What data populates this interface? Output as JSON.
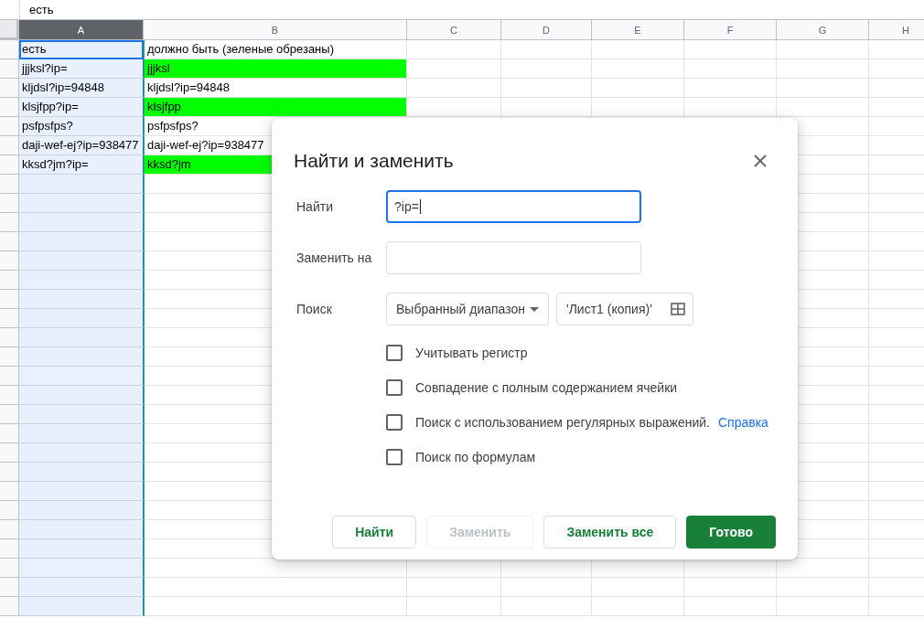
{
  "formula_bar": {
    "value": "есть"
  },
  "columns": [
    {
      "label": "A",
      "selected": true
    },
    {
      "label": "B",
      "selected": false
    },
    {
      "label": "C",
      "selected": false
    },
    {
      "label": "D",
      "selected": false
    },
    {
      "label": "E",
      "selected": false
    },
    {
      "label": "F",
      "selected": false
    },
    {
      "label": "G",
      "selected": false
    },
    {
      "label": "H",
      "selected": false
    }
  ],
  "rows": [
    {
      "cells": [
        {
          "text": "есть",
          "highlighted": false
        },
        {
          "text": "должно быть (зеленые обрезаны)",
          "highlighted": false
        }
      ]
    },
    {
      "cells": [
        {
          "text": "jjjksl?ip=",
          "highlighted": false
        },
        {
          "text": "jjjksl",
          "highlighted": true
        }
      ]
    },
    {
      "cells": [
        {
          "text": "kljdsl?ip=94848",
          "highlighted": false
        },
        {
          "text": "kljdsl?ip=94848",
          "highlighted": false
        }
      ]
    },
    {
      "cells": [
        {
          "text": "klsjfpp?ip=",
          "highlighted": false
        },
        {
          "text": "klsjfpp",
          "highlighted": true
        }
      ]
    },
    {
      "cells": [
        {
          "text": "psfpsfps?",
          "highlighted": false
        },
        {
          "text": "psfpsfps?",
          "highlighted": false
        }
      ]
    },
    {
      "cells": [
        {
          "text": "daji-wef-ej?ip=938477",
          "highlighted": false
        },
        {
          "text": "daji-wef-ej?ip=938477",
          "highlighted": false
        }
      ]
    },
    {
      "cells": [
        {
          "text": "kksd?jm?ip=",
          "highlighted": false
        },
        {
          "text": "kksd?jm",
          "highlighted": true
        }
      ]
    }
  ],
  "dialog": {
    "title": "Найти и заменить",
    "find": {
      "label": "Найти",
      "value": "?ip=",
      "focused": true
    },
    "replace": {
      "label": "Заменить на",
      "focused": false
    },
    "search": {
      "label": "Поиск",
      "scope": "Выбранный диапазон",
      "range": "'Лист1 (копия)'"
    },
    "options": [
      {
        "label": "Учитывать регистр",
        "checked": false
      },
      {
        "label": "Совпадение с полным содержанием ячейки",
        "checked": false
      },
      {
        "label": "Поиск с использованием регулярных выражений.",
        "link": "Справка",
        "checked": false
      },
      {
        "label": "Поиск по формулам",
        "checked": false
      }
    ],
    "buttons": [
      {
        "label": "Найти",
        "kind": "outline"
      },
      {
        "label": "Заменить",
        "kind": "disabled"
      },
      {
        "label": "Заменить все",
        "kind": "outline"
      },
      {
        "label": "Готово",
        "kind": "primary"
      }
    ]
  }
}
